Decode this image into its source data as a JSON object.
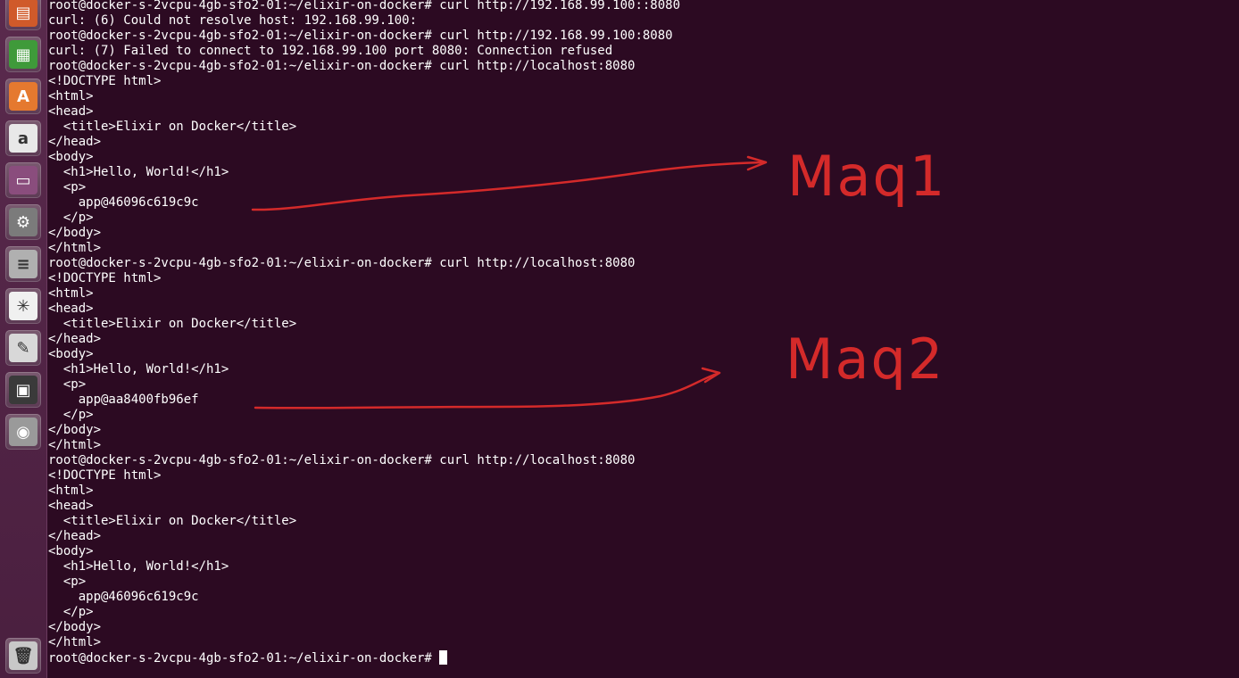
{
  "launcher": {
    "icons": [
      {
        "name": "libreoffice-impress-icon",
        "glyph": "▤",
        "bg": "#d05a2a"
      },
      {
        "name": "libreoffice-calc-icon",
        "glyph": "▦",
        "bg": "#3f9a3a"
      },
      {
        "name": "software-center-icon",
        "glyph": "A",
        "bg": "#e5792f"
      },
      {
        "name": "amazon-icon",
        "glyph": "a",
        "bg": "#e8e8e8"
      },
      {
        "name": "remote-desktop-icon",
        "glyph": "▭",
        "bg": "#8a4d7d"
      },
      {
        "name": "system-settings-icon",
        "glyph": "⚙",
        "bg": "#7b7b7b"
      },
      {
        "name": "server-icon",
        "glyph": "≡",
        "bg": "#b0b0b0"
      },
      {
        "name": "pinwheel-app-icon",
        "glyph": "✳",
        "bg": "#f0f0f0"
      },
      {
        "name": "text-editor-icon",
        "glyph": "✎",
        "bg": "#d8d8d8"
      },
      {
        "name": "screen-lock-icon",
        "glyph": "▣",
        "bg": "#3a3a3a"
      },
      {
        "name": "camera-icon",
        "glyph": "◉",
        "bg": "#9a9a9a"
      },
      {
        "name": "trash-icon",
        "glyph": "🗑",
        "bg": "#c8c8c8"
      }
    ]
  },
  "terminal": {
    "lines": [
      "root@docker-s-2vcpu-4gb-sfo2-01:~/elixir-on-docker# curl http://192.168.99.100::8080",
      "curl: (6) Could not resolve host: 192.168.99.100:",
      "root@docker-s-2vcpu-4gb-sfo2-01:~/elixir-on-docker# curl http://192.168.99.100:8080",
      "curl: (7) Failed to connect to 192.168.99.100 port 8080: Connection refused",
      "root@docker-s-2vcpu-4gb-sfo2-01:~/elixir-on-docker# curl http://localhost:8080",
      "<!DOCTYPE html>",
      "<html>",
      "<head>",
      "  <title>Elixir on Docker</title>",
      "</head>",
      "<body>",
      "  <h1>Hello, World!</h1>",
      "  <p>",
      "    app@46096c619c9c",
      "  </p>",
      "</body>",
      "</html>",
      "root@docker-s-2vcpu-4gb-sfo2-01:~/elixir-on-docker# curl http://localhost:8080",
      "<!DOCTYPE html>",
      "<html>",
      "<head>",
      "  <title>Elixir on Docker</title>",
      "</head>",
      "<body>",
      "  <h1>Hello, World!</h1>",
      "  <p>",
      "    app@aa8400fb96ef",
      "  </p>",
      "</body>",
      "</html>",
      "root@docker-s-2vcpu-4gb-sfo2-01:~/elixir-on-docker# curl http://localhost:8080",
      "<!DOCTYPE html>",
      "<html>",
      "<head>",
      "  <title>Elixir on Docker</title>",
      "</head>",
      "<body>",
      "  <h1>Hello, World!</h1>",
      "  <p>",
      "    app@46096c619c9c",
      "  </p>",
      "</body>",
      "</html>"
    ],
    "prompt": "root@docker-s-2vcpu-4gb-sfo2-01:~/elixir-on-docker# "
  },
  "annotations": {
    "color": "#d42a2a",
    "label1": "Maq1",
    "label2": "Maq2"
  }
}
